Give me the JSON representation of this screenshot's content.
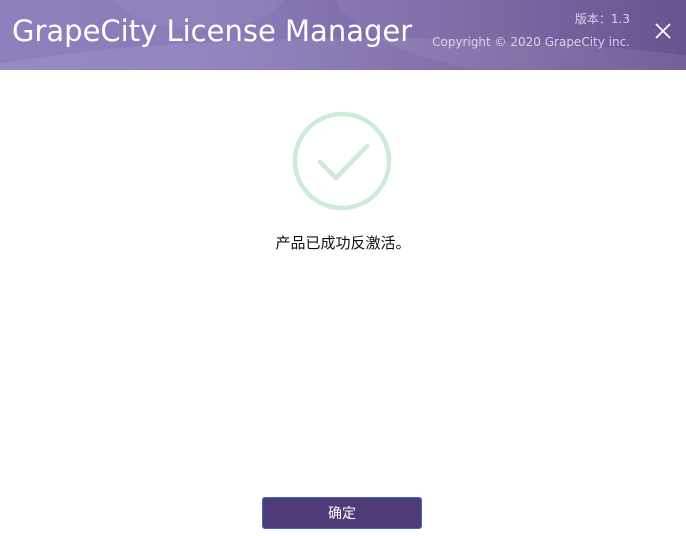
{
  "header": {
    "title": "GrapeCity License Manager",
    "version_label": "版本：",
    "version_number": "1.3",
    "copyright": "Copyright © 2020 GrapeCity inc.",
    "close_icon": "close-icon"
  },
  "main": {
    "status_icon": "check-circle-icon",
    "message": "产品已成功反激活。"
  },
  "footer": {
    "ok_label": "确定"
  },
  "colors": {
    "header_start": "#8f80bd",
    "header_end": "#5e4a89",
    "check_color": "#cdebd8",
    "button_bg": "#4f3b78",
    "button_border": "#3a6fb3"
  }
}
